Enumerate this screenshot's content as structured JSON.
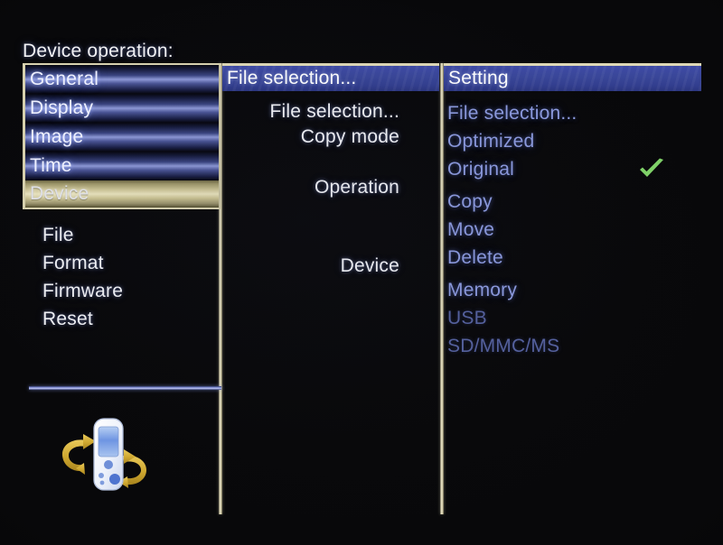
{
  "screen": {
    "title": "Device operation:",
    "background_color": "#000000",
    "accent_border_color": "#ded8b6",
    "header_blue": "#3a46a0",
    "check_color": "#7fd168"
  },
  "left_panel": {
    "categories": [
      {
        "label": "General",
        "state": "normal"
      },
      {
        "label": "Display",
        "state": "normal"
      },
      {
        "label": "Image",
        "state": "normal"
      },
      {
        "label": "Time",
        "state": "normal"
      },
      {
        "label": "Device",
        "state": "selected"
      }
    ],
    "sub_items": [
      {
        "label": "File"
      },
      {
        "label": "Format"
      },
      {
        "label": "Firmware"
      },
      {
        "label": "Reset"
      }
    ],
    "icon": {
      "name": "device-rotate-icon",
      "description": "portable media player with rotation arrows"
    }
  },
  "middle_panel": {
    "header": "File selection...",
    "items": [
      {
        "label": "File selection...",
        "spacing": "gap-sm"
      },
      {
        "label": "Copy mode",
        "spacing": "gap-sm"
      },
      {
        "label": "Operation",
        "spacing": "gap-lg"
      },
      {
        "label": "Device",
        "spacing": "gap-xl"
      }
    ]
  },
  "right_panel": {
    "header": "Setting",
    "items": [
      {
        "label": "File selection...",
        "state": "bright",
        "checked": false,
        "spaced": false
      },
      {
        "label": "Optimized",
        "state": "bright",
        "checked": false,
        "spaced": false
      },
      {
        "label": "Original",
        "state": "bright",
        "checked": true,
        "spaced": false
      },
      {
        "label": "Copy",
        "state": "bright",
        "checked": false,
        "spaced": true
      },
      {
        "label": "Move",
        "state": "bright",
        "checked": false,
        "spaced": false
      },
      {
        "label": "Delete",
        "state": "bright",
        "checked": false,
        "spaced": false
      },
      {
        "label": "Memory",
        "state": "bright",
        "checked": false,
        "spaced": true
      },
      {
        "label": "USB",
        "state": "dim",
        "checked": false,
        "spaced": false
      },
      {
        "label": "SD/MMC/MS",
        "state": "dim",
        "checked": false,
        "spaced": false
      }
    ]
  }
}
